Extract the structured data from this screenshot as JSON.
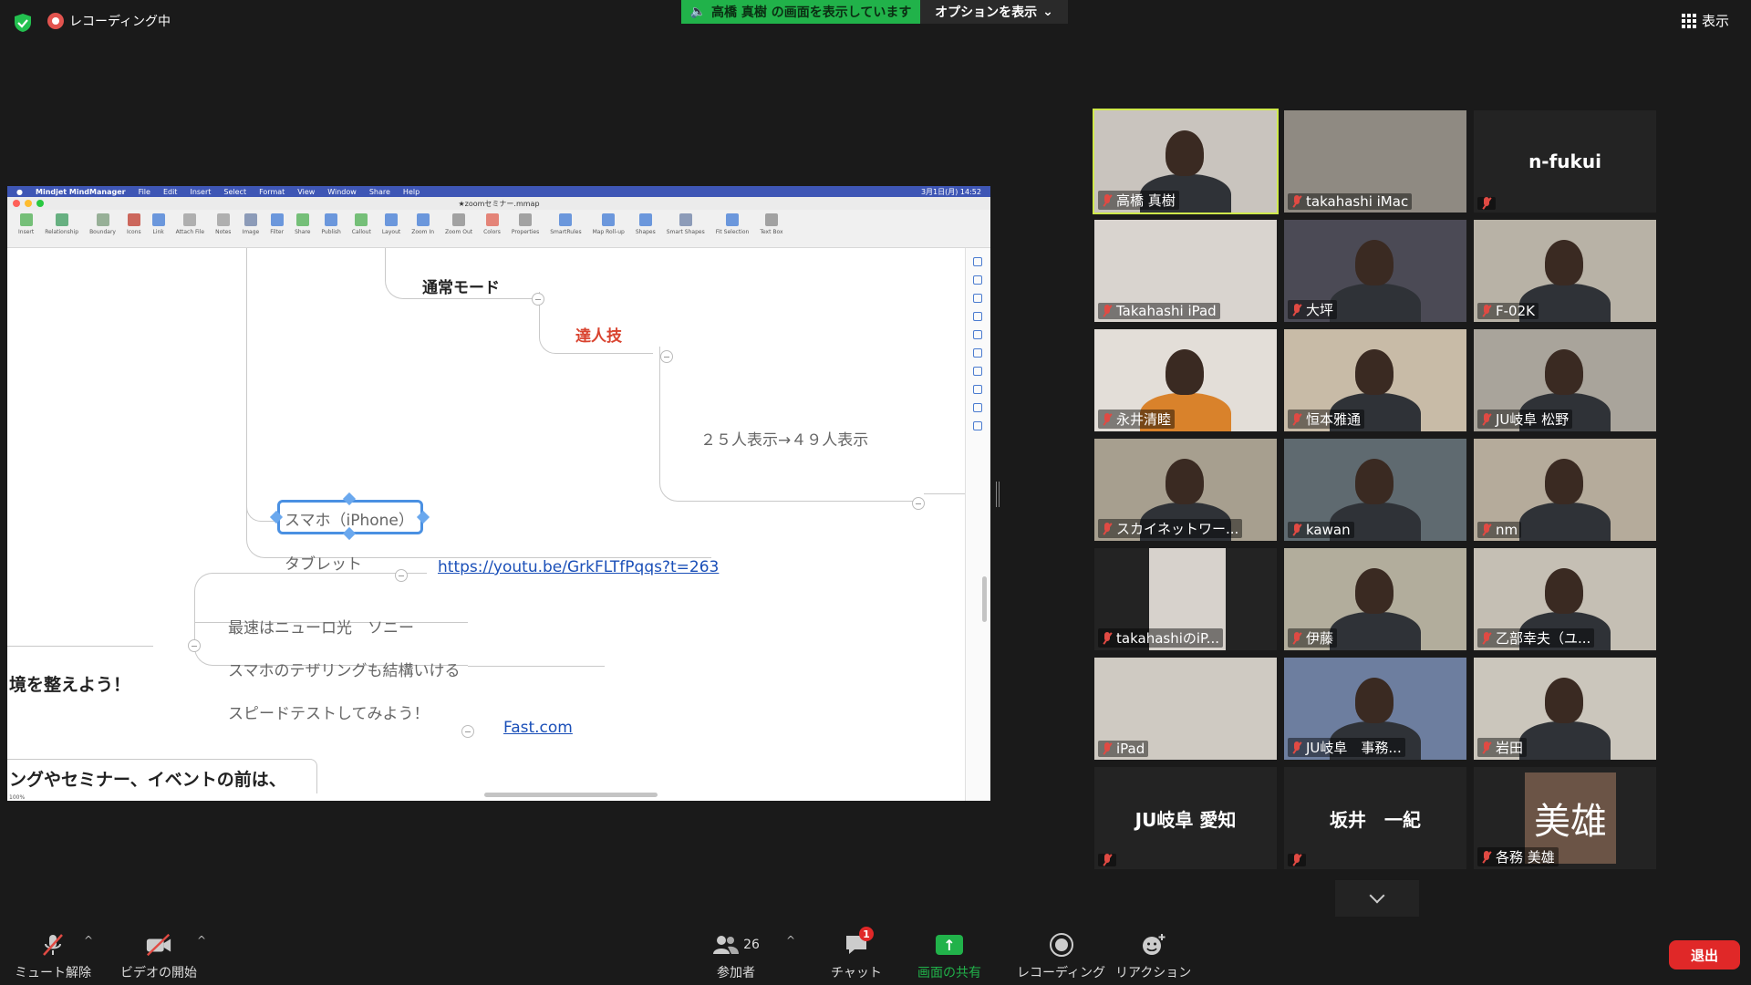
{
  "topbar": {
    "recording_label": "レコーディング中",
    "share_banner": "高橋 真樹 の画面を表示しています",
    "options_label": "オプションを表示",
    "view_label": "表示"
  },
  "shared_screen": {
    "mac_menu": [
      "Mindjet MindManager",
      "File",
      "Edit",
      "Insert",
      "Select",
      "Format",
      "View",
      "Window",
      "Share",
      "Help"
    ],
    "mac_clock": "3月1日(月) 14:52",
    "window_title": "★zoomセミナー.mmap",
    "tools": [
      "Insert",
      "Relationship",
      "Boundary",
      "Icons",
      "Link",
      "Attach File",
      "Notes",
      "Image",
      "Filter",
      "Share",
      "Publish",
      "Callout",
      "Layout",
      "Zoom In",
      "Zoom Out",
      "Colors",
      "Properties",
      "SmartRules",
      "Map Roll-up",
      "Shapes",
      "Smart Shapes",
      "Fit Selection",
      "Text Box"
    ],
    "zoom_level": "100%",
    "mindmap": {
      "normal_mode": "通常モード",
      "master_skill": "達人技",
      "display_switch": "２５人表示→４９人表示",
      "smartphone": "スマホ（iPhone）",
      "tablet": "タブレット",
      "youtube_link": "https://youtu.be/GrkFLTfPqqs?t=263",
      "fastest": "最速はニューロ光　ソニー",
      "tethering": "スマホのテザリングも結構いける",
      "speedtest": "スピードテストしてみよう！",
      "fast_link": "Fast.com",
      "env_node": "境を整えよう！",
      "bottom_node": "ングやセミナー、イベントの前は、"
    }
  },
  "participants": [
    {
      "name": "高橋 真樹",
      "active": true,
      "video": true
    },
    {
      "name": "takahashi iMac",
      "video": true
    },
    {
      "name": "n-fukui",
      "video": false
    },
    {
      "name": "Takahashi iPad",
      "video": true
    },
    {
      "name": "大坪",
      "video": true
    },
    {
      "name": "F-02K",
      "video": true
    },
    {
      "name": "永井清睦",
      "video": true
    },
    {
      "name": "恒本雅通",
      "video": true
    },
    {
      "name": "JU岐阜 松野",
      "video": true
    },
    {
      "name": "スカイネットワー...",
      "video": true
    },
    {
      "name": "kawan",
      "video": true
    },
    {
      "name": "nm",
      "video": true
    },
    {
      "name": "takahashiのiP...",
      "video": true
    },
    {
      "name": "伊藤",
      "video": true
    },
    {
      "name": "乙部幸夫（ユ...",
      "video": true
    },
    {
      "name": "iPad",
      "video": true
    },
    {
      "name": "JU岐阜　事務...",
      "video": true
    },
    {
      "name": "岩田",
      "video": true
    },
    {
      "name": "JU岐阜 愛知",
      "video": false
    },
    {
      "name": "坂井　一紀",
      "video": false
    },
    {
      "name": "各務 美雄",
      "video": false,
      "avatar_text": "美雄"
    }
  ],
  "bottombar": {
    "unmute": "ミュート解除",
    "start_video": "ビデオの開始",
    "participants": "参加者",
    "participant_count": "26",
    "chat": "チャット",
    "chat_badge": "1",
    "share": "画面の共有",
    "record": "レコーディング",
    "reaction": "リアクション",
    "leave": "退出"
  },
  "colors": {
    "share_green": "#21b24a",
    "leave_red": "#e02828",
    "active_speaker": "#cfe94b",
    "mindmap_link": "#1a4fb8",
    "mindmap_red": "#d9432f"
  }
}
